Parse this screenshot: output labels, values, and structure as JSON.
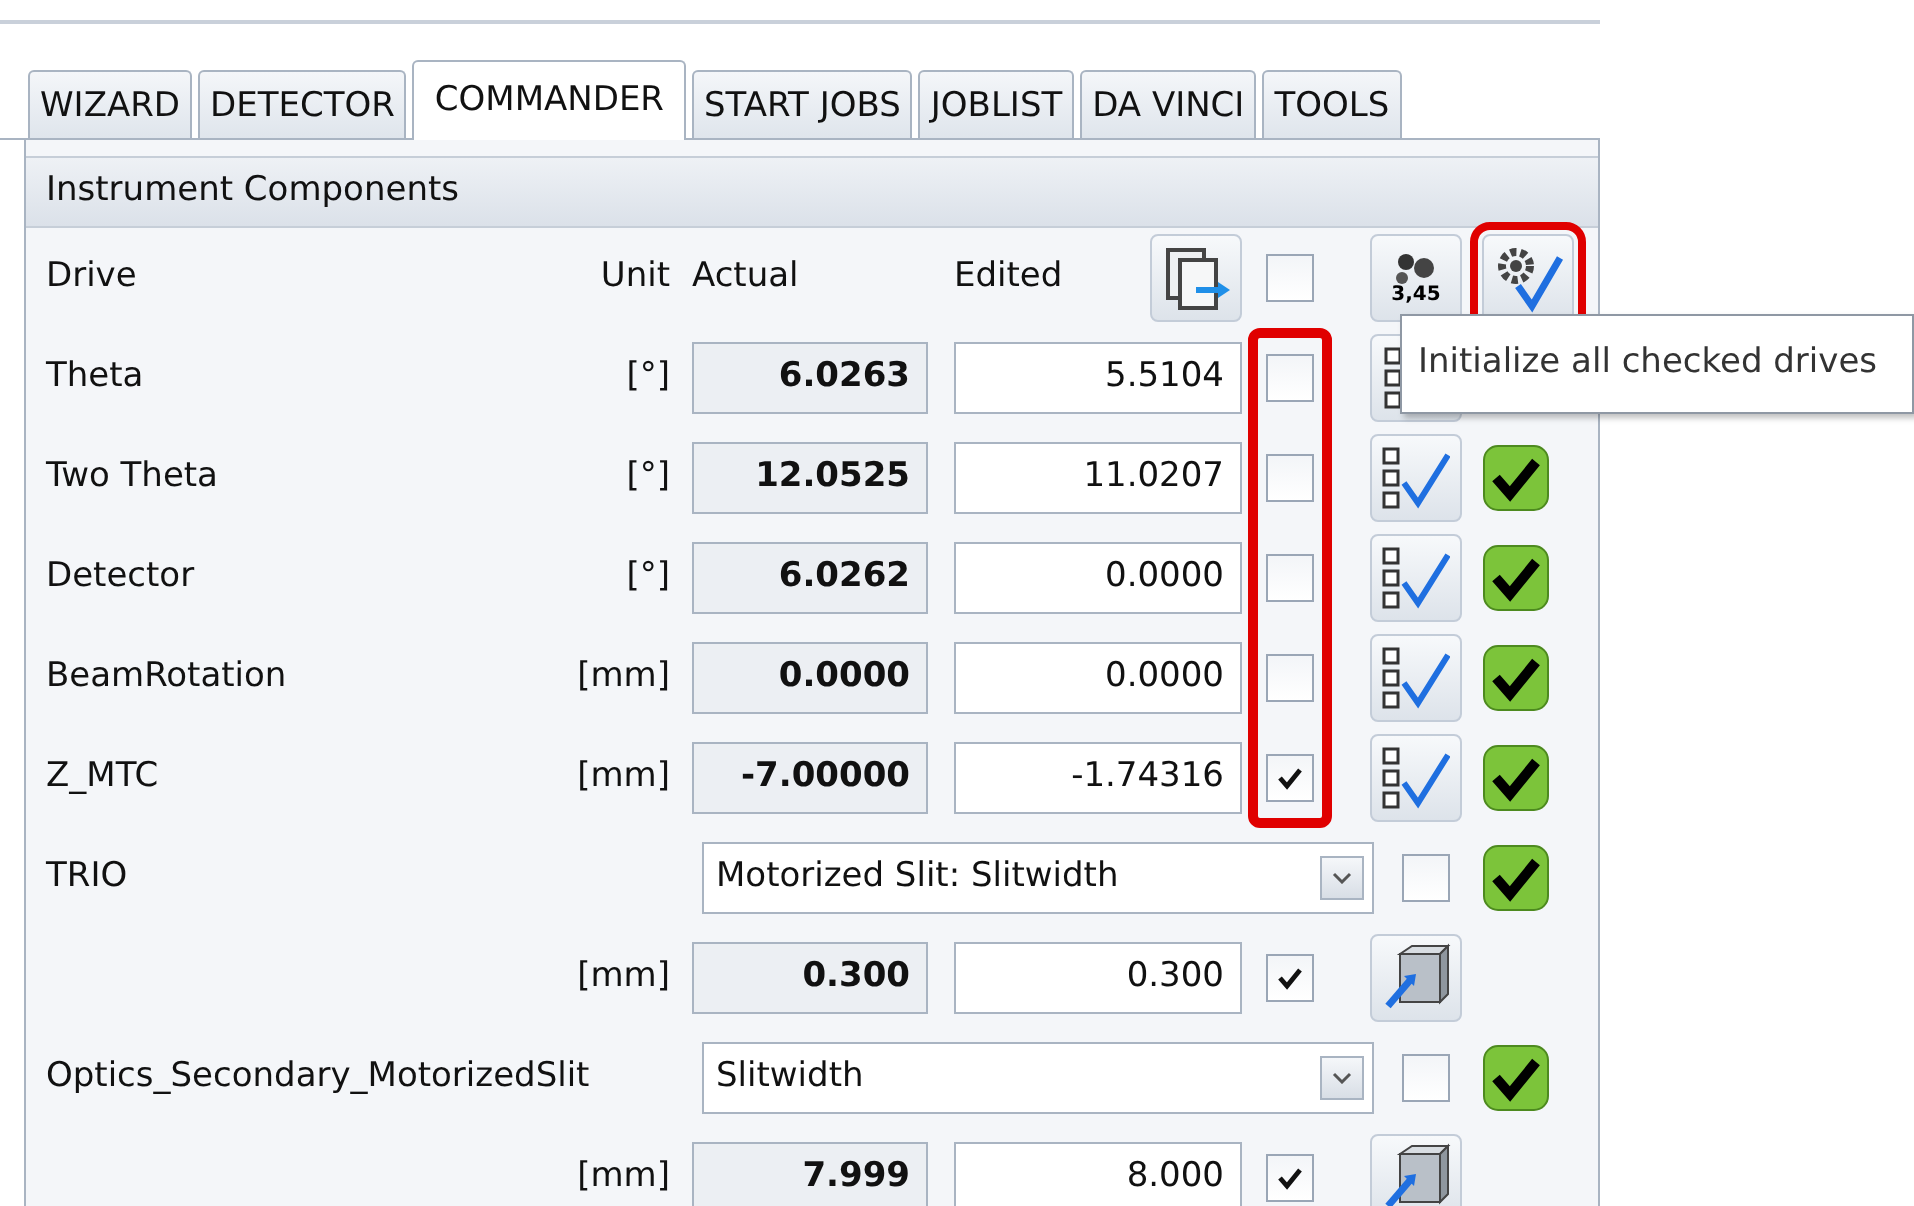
{
  "tabs": [
    {
      "label": "WIZARD",
      "selected": false
    },
    {
      "label": "DETECTOR",
      "selected": false
    },
    {
      "label": "COMMANDER",
      "selected": true
    },
    {
      "label": "START JOBS",
      "selected": false
    },
    {
      "label": "JOBLIST",
      "selected": false
    },
    {
      "label": "DA VINCI",
      "selected": false
    },
    {
      "label": "TOOLS",
      "selected": false
    }
  ],
  "section_title": "Instrument Components",
  "header": {
    "drive": "Drive",
    "unit": "Unit",
    "actual": "Actual",
    "edited": "Edited",
    "select_all_checked": false,
    "format_label": "3,45",
    "init_all_highlighted": true
  },
  "checkbox_column_highlighted": true,
  "tooltip": "Initialize all checked drives",
  "rows": [
    {
      "kind": "drive",
      "name": "Theta",
      "unit": "[°]",
      "actual": "6.0263",
      "edited": "5.5104",
      "checked": false
    },
    {
      "kind": "drive",
      "name": "Two Theta",
      "unit": "[°]",
      "actual": "12.0525",
      "edited": "11.0207",
      "checked": false,
      "status_ok": true
    },
    {
      "kind": "drive",
      "name": "Detector",
      "unit": "[°]",
      "actual": "6.0262",
      "edited": "0.0000",
      "checked": false,
      "status_ok": true
    },
    {
      "kind": "drive",
      "name": "BeamRotation",
      "unit": "[mm]",
      "actual": "0.0000",
      "edited": "0.0000",
      "checked": false,
      "status_ok": true
    },
    {
      "kind": "drive",
      "name": "Z_MTC",
      "unit": "[mm]",
      "actual": "-7.00000",
      "edited": "-1.74316",
      "checked": true,
      "status_ok": true
    },
    {
      "kind": "component",
      "name": "TRIO",
      "value": "Motorized Slit: Slitwidth",
      "checked": false,
      "status_ok": true
    },
    {
      "kind": "setting",
      "unit": "[mm]",
      "actual": "0.300",
      "edited": "0.300",
      "checked": true
    },
    {
      "kind": "component",
      "name": "Optics_Secondary_MotorizedSlit",
      "value": "Slitwidth",
      "checked": false,
      "status_ok": true
    },
    {
      "kind": "setting",
      "unit": "[mm]",
      "actual": "7.999",
      "edited": "8.000",
      "checked": true
    }
  ]
}
